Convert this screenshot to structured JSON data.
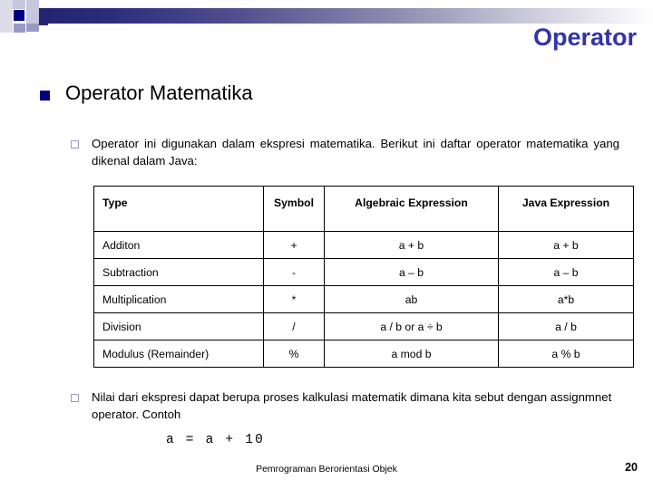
{
  "slide": {
    "title": "Operator",
    "title_color": "#3333AA",
    "heading": "Operator Matematika",
    "heading_bullet_icon": "filled-square-bullet-icon",
    "heading_bullet_color": "#000080"
  },
  "paragraphs": [
    {
      "bullet_icon": "hollow-square-bullet-icon",
      "text": "Operator ini digunakan dalam ekspresi matematika. Berikut ini daftar operator matematika yang dikenal dalam Java:"
    },
    {
      "bullet_icon": "hollow-square-bullet-icon",
      "text": "Nilai dari ekspresi dapat berupa proses kalkulasi matematik dimana kita sebut dengan assignmnet operator. Contoh"
    }
  ],
  "code_example": "a = a + 10",
  "table": {
    "headers": [
      "Type",
      "Symbol",
      "Algebraic Expression",
      "Java Expression"
    ],
    "rows": [
      [
        "Additon",
        "+",
        "a + b",
        "a + b"
      ],
      [
        "Subtraction",
        "-",
        "a – b",
        "a – b"
      ],
      [
        "Multiplication",
        "*",
        "ab",
        "a*b"
      ],
      [
        "Division",
        "/",
        "a / b or a ÷ b",
        "a / b"
      ],
      [
        "Modulus (Remainder)",
        "%",
        "a mod b",
        "a % b"
      ]
    ]
  },
  "footer": {
    "text": "Pemrograman Berorientasi Objek",
    "page_number": "20"
  }
}
